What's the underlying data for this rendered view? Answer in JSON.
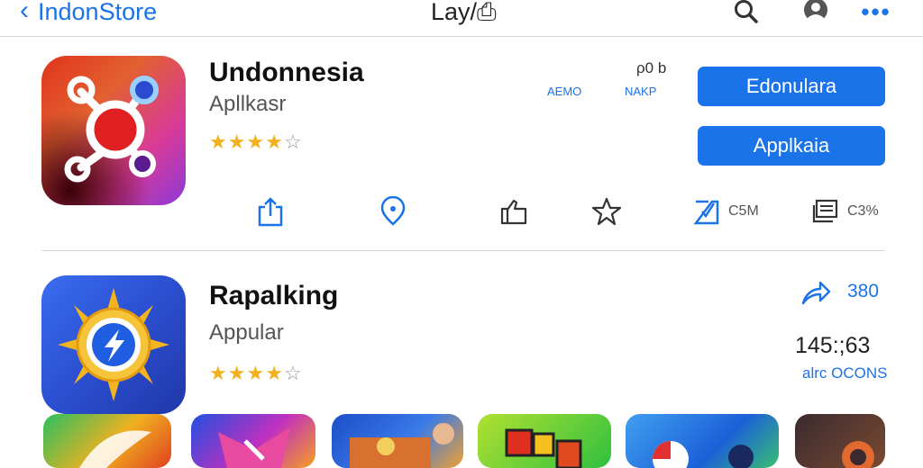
{
  "header": {
    "back_label": "IndonStore",
    "title": "Lay/⎙"
  },
  "apps": [
    {
      "name": "Undonnesia",
      "category": "Apllkasr",
      "rating": 4,
      "stats": {
        "top": "ρ0 b",
        "label_a": "AEMO",
        "label_b": "NAKP"
      },
      "buttons": [
        "Edonulara",
        "Applkaia"
      ],
      "actions": [
        {
          "icon": "share-icon"
        },
        {
          "icon": "location-pin-icon"
        },
        {
          "icon": "thumbs-up-icon"
        },
        {
          "icon": "star-icon"
        },
        {
          "icon": "bookmark-icon",
          "label": "C5M"
        },
        {
          "icon": "document-icon",
          "label": "C3%"
        }
      ]
    },
    {
      "name": "Rapalking",
      "category": "Appular",
      "rating": 4,
      "share_value": "380",
      "time": "145:;63",
      "meta": "alrc OCONS"
    }
  ],
  "colors": {
    "accent": "#1a73e8",
    "star": "#f2b01e"
  }
}
